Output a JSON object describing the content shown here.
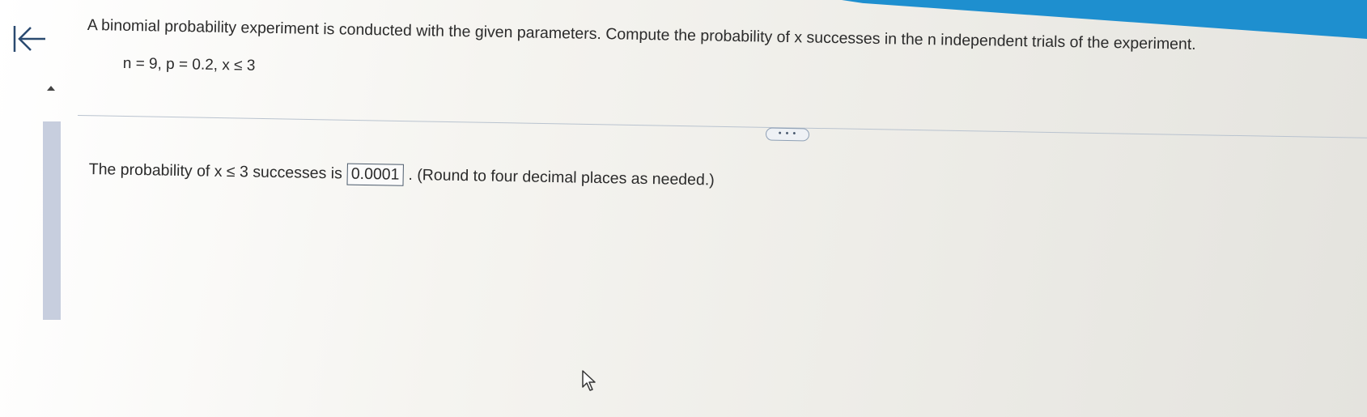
{
  "header": {
    "back_icon": "first-page-arrow-icon",
    "accent_color": "#1e8fcf"
  },
  "question": {
    "prompt": "A binomial probability experiment is conducted with the given parameters. Compute the probability of x successes in the n independent trials of the experiment.",
    "parameters": "n = 9, p = 0.2, x ≤ 3"
  },
  "toolbar": {
    "more_label": "• • •"
  },
  "answer": {
    "prefix": "The probability of x ≤ 3 successes is",
    "value": "0.0001",
    "suffix": ". (Round to four decimal places as needed.)"
  }
}
